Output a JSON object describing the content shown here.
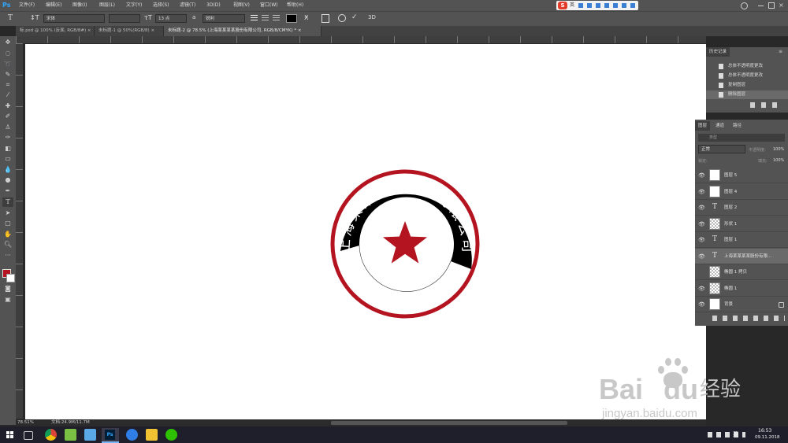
{
  "app": {
    "logo": "Ps"
  },
  "menu": [
    "文件(F)",
    "编辑(E)",
    "图像(I)",
    "图层(L)",
    "文字(Y)",
    "选择(S)",
    "滤镜(T)",
    "3D(D)",
    "视图(V)",
    "窗口(W)",
    "帮助(H)"
  ],
  "ime": {
    "label": "英"
  },
  "options": {
    "font_family": "宋体",
    "font_style": "",
    "font_size": "13 点",
    "aa_label": "a",
    "aa_mode": "锐利"
  },
  "tabs": [
    {
      "label": "标.psd @ 100% (反面, RGB/8#)",
      "active": false
    },
    {
      "label": "未标题-1 @ 50%(RGB/8)",
      "active": false
    },
    {
      "label": "未标题-2 @ 78.5% (上海某某某某股份有限公司, RGB/8/CMYK) *",
      "active": true
    }
  ],
  "seal": {
    "text": "上海某某某某股份有限公司",
    "color": "#b4141f",
    "star_color": "#b4141f"
  },
  "status": {
    "zoom": "78.51%",
    "doc": "文档:24.9M/11.7M"
  },
  "history": {
    "tab": "历史记录",
    "items": [
      "总体不透明度更改",
      "总体不透明度更改",
      "复制图层",
      "删除图层"
    ]
  },
  "layers_panel": {
    "tabs": [
      "图层",
      "通道",
      "路径"
    ],
    "search_placeholder": "类型",
    "blend_mode": "正常",
    "opacity_label": "不透明度:",
    "opacity": "100%",
    "lock_label": "锁定:",
    "fill_label": "填充:",
    "fill": "100%",
    "layers": [
      {
        "name": "图层 5",
        "thumb": "white",
        "visible": true
      },
      {
        "name": "图层 4",
        "thumb": "white",
        "visible": true
      },
      {
        "name": "图层 2",
        "thumb": "text",
        "visible": true
      },
      {
        "name": "形状 1",
        "thumb": "checker",
        "visible": true
      },
      {
        "name": "图层 1",
        "thumb": "text",
        "visible": true
      },
      {
        "name": "上海某某某某股份有限...",
        "thumb": "text",
        "visible": true,
        "selected": true
      },
      {
        "name": "椭圆 1 拷贝",
        "thumb": "checker",
        "visible": false
      },
      {
        "name": "椭圆 1",
        "thumb": "checker",
        "visible": true
      },
      {
        "name": "背景",
        "thumb": "white",
        "visible": true,
        "locked": true
      }
    ]
  },
  "taskbar": {
    "time": "16:53",
    "date": "09.11.2018",
    "lang": "英"
  },
  "watermark": {
    "brand": "Bai",
    "brand2": "du",
    "cn": "经验",
    "url": "jingyan.baidu.com"
  }
}
